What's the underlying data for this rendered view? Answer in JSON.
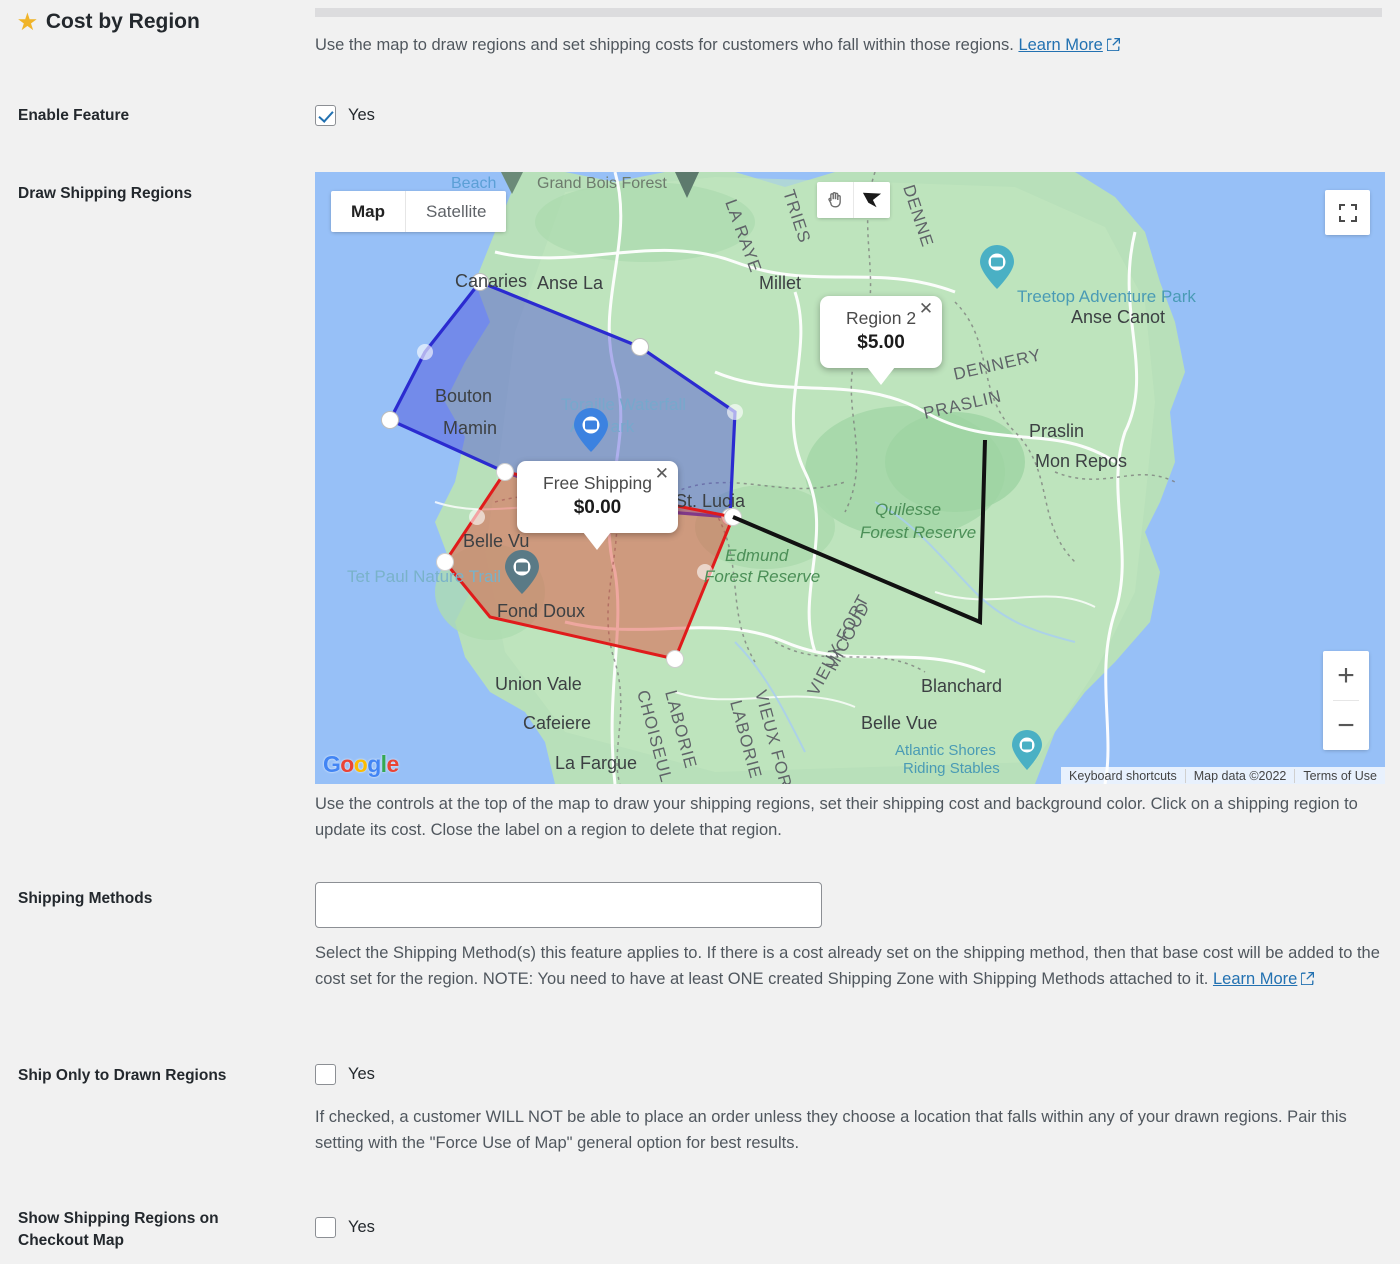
{
  "header": {
    "title": "Cost by Region",
    "star_icon": "star-icon",
    "intro_text": "Use the map to draw regions and set shipping costs for customers who fall within those regions.",
    "learn_more": "Learn More"
  },
  "rows": {
    "enable_feature": {
      "label": "Enable Feature",
      "checkbox_label": "Yes",
      "checked": true
    },
    "draw_shipping_regions": {
      "label": "Draw Shipping Regions",
      "help": "Use the controls at the top of the map to draw your shipping regions, set their shipping cost and background color. Click on a shipping region to update its cost. Close the label on a region to delete that region."
    },
    "shipping_methods": {
      "label": "Shipping Methods",
      "value": "",
      "placeholder": "",
      "help_part1": "Select the Shipping Method(s) this feature applies to. If there is a cost already set on the shipping method, then that base cost will be added to the cost set for the region. NOTE: You need to have at least ONE created Shipping Zone with Shipping Methods attached to it.",
      "learn_more": "Learn More"
    },
    "ship_only_drawn": {
      "label": "Ship Only to Drawn Regions",
      "checkbox_label": "Yes",
      "checked": false,
      "help": "If checked, a customer WILL NOT be able to place an order unless they choose a location that falls within any of your drawn regions. Pair this setting with the \"Force Use of Map\" general option for best results."
    },
    "show_regions_checkout": {
      "label": "Show Shipping Regions on Checkout Map",
      "checkbox_label": "Yes",
      "checked": false
    }
  },
  "map": {
    "type_controls": [
      {
        "label": "Map",
        "active": true
      },
      {
        "label": "Satellite",
        "active": false
      }
    ],
    "tools": [
      {
        "name": "pan-hand-icon"
      },
      {
        "name": "polygon-draw-icon"
      }
    ],
    "fullscreen_icon": "fullscreen-icon",
    "zoom_in_label": "+",
    "zoom_out_label": "−",
    "google_logo": "Google",
    "attribution": [
      "Keyboard shortcuts",
      "Map data ©2022",
      "Terms of Use"
    ],
    "regions": [
      {
        "name": "Region 2",
        "cost": "$5.00",
        "color": "#3b3bdb",
        "close_icon": "close-icon"
      },
      {
        "name": "Free Shipping",
        "cost": "$0.00",
        "color": "#e02020",
        "close_icon": "close-icon"
      }
    ],
    "labels": [
      "Beach",
      "Grand Bois Forest",
      "LA RAYE",
      "TRIES",
      "DENNE",
      "Millet",
      "Canaries",
      "Anse La",
      "Treetop Adventure Park",
      "Anse Canot",
      "DENNERY",
      "PRASLIN",
      "Praslin",
      "Mon Repos",
      "Bouton",
      "Mamin",
      "Toraille Waterfall Atv Park",
      "St. Lucia",
      "Quilesse Forest Reserve",
      "Edmund Forest Reserve",
      "Belle Vu",
      "Tet Paul Nature Trail",
      "Fond Doux",
      "MICOUD VIEUX FORT",
      "Blanchard",
      "Belle Vue",
      "Union Vale",
      "Cafeiere",
      "La Fargue",
      "CHOISEUL",
      "LABORIE",
      "VIEUX FORT",
      "Atlantic Shores Riding Stables"
    ]
  }
}
